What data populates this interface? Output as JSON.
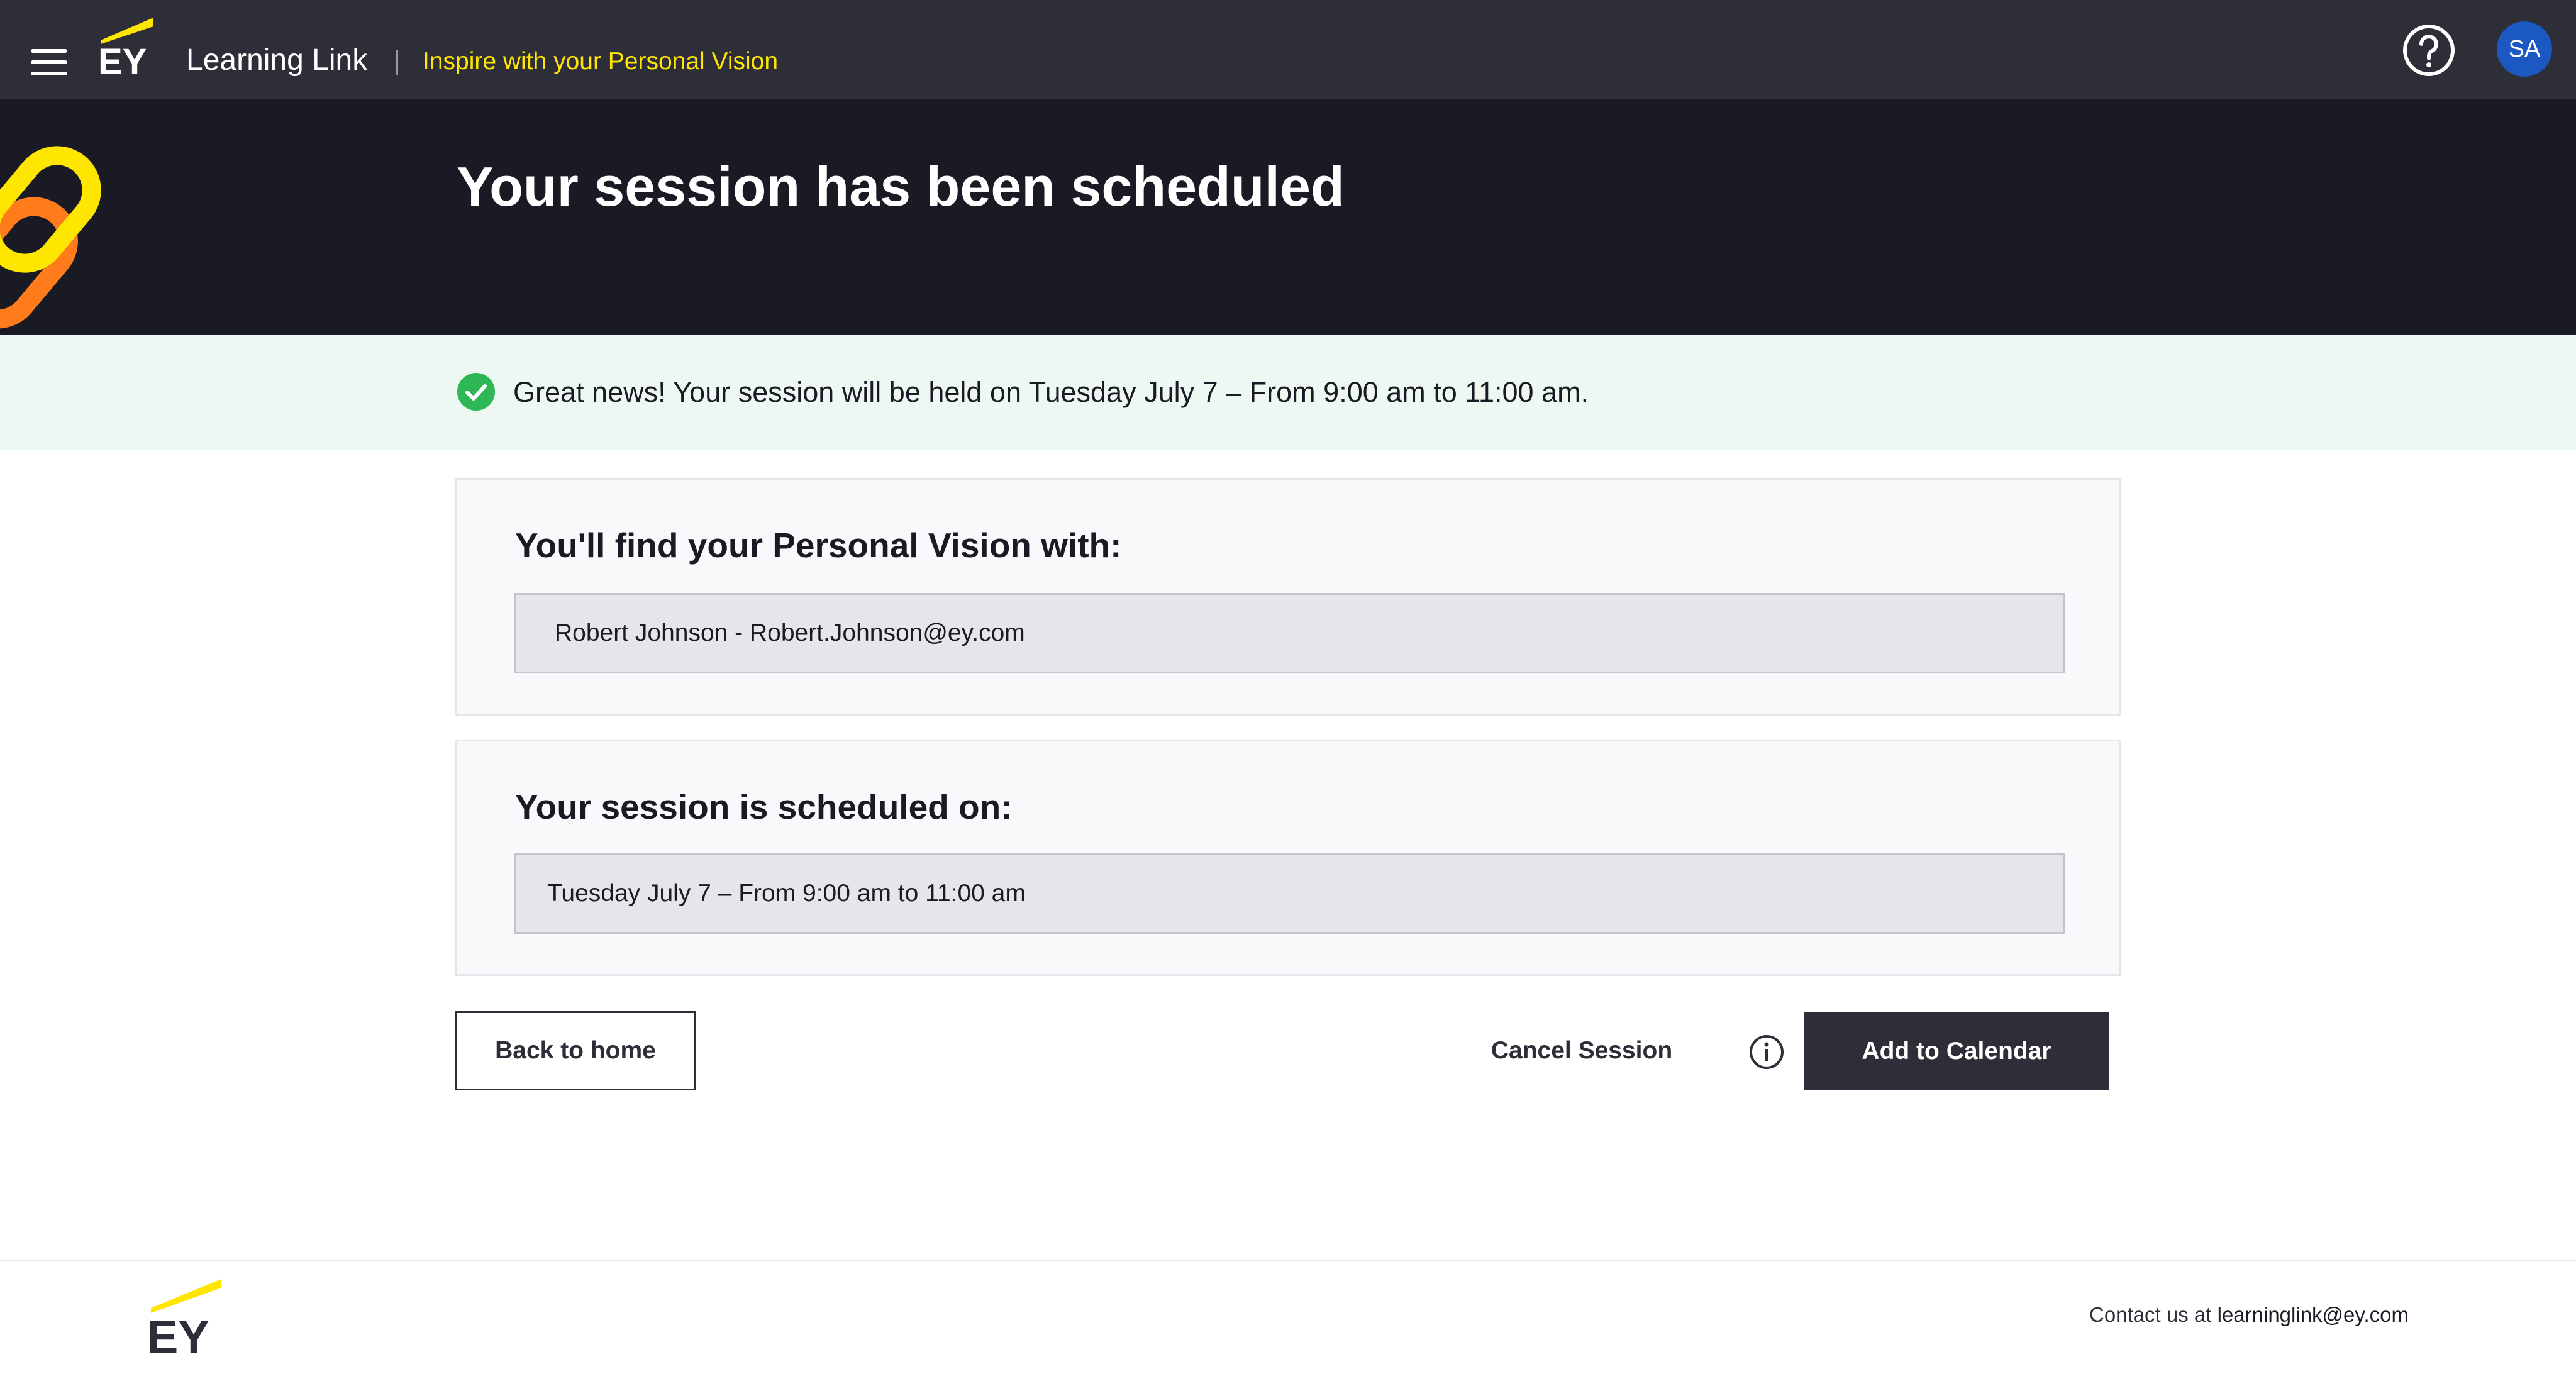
{
  "header": {
    "menu_icon": "hamburger-menu-icon",
    "logo_text": "EY",
    "app_title": "Learning Link",
    "tagline": "Inspire with your Personal Vision",
    "help_icon": "question-circle-icon",
    "avatar_initials": "SA",
    "colors": {
      "bar": "#2e2e38",
      "accent": "#ffe600",
      "avatar": "#1c58c2"
    }
  },
  "hero": {
    "title": "Your session has been scheduled",
    "graphic_icon": "chain-link-icon",
    "background": "#1a1a24"
  },
  "banner": {
    "icon": "check-circle-icon",
    "message": "Great news! Your session will be held on Tuesday July 7 – From 9:00 am to 11:00 am.",
    "background": "#eef8f2",
    "icon_color": "#2db757"
  },
  "cards": {
    "vision_with": {
      "heading": "You'll find your Personal Vision with:",
      "value": "Robert Johnson - Robert.Johnson@ey.com"
    },
    "scheduled_on": {
      "heading": "Your session is scheduled on:",
      "value": "Tuesday July 7 – From 9:00 am to 11:00 am"
    }
  },
  "actions": {
    "back_label": "Back to home",
    "cancel_label": "Cancel Session",
    "info_icon": "info-circle-icon",
    "add_calendar_label": "Add to Calendar"
  },
  "footer": {
    "logo_text": "EY",
    "contact_prefix": "Contact us at ",
    "contact_email": "learninglink@ey.com"
  }
}
